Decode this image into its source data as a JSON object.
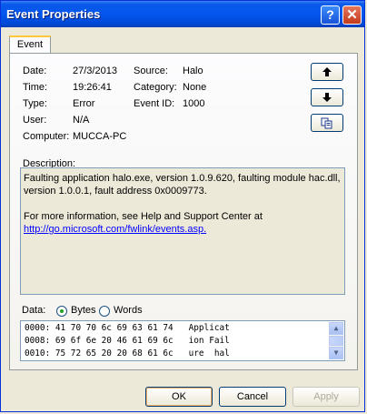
{
  "window": {
    "title": "Event Properties",
    "help_glyph": "?",
    "close_glyph": "✕"
  },
  "tab": {
    "label": "Event"
  },
  "fields": {
    "date_label": "Date:",
    "date_value": "27/3/2013",
    "time_label": "Time:",
    "time_value": "19:26:41",
    "type_label": "Type:",
    "type_value": "Error",
    "user_label": "User:",
    "user_value": "N/A",
    "computer_label": "Computer:",
    "computer_value": "MUCCA-PC",
    "source_label": "Source:",
    "source_value": "Halo",
    "category_label": "Category:",
    "category_value": "None",
    "eventid_label": "Event ID:",
    "eventid_value": "1000"
  },
  "nav": {
    "up_glyph": "🡑",
    "down_glyph": "🡓",
    "copy_icon": "copy-icon"
  },
  "description": {
    "label": "Description:",
    "line1": "Faulting application halo.exe, version 1.0.9.620, faulting module hac.dll,",
    "line2": "version 1.0.0.1, fault address 0x0009773.",
    "line3": "For more information, see Help and Support Center at",
    "link": "http://go.microsoft.com/fwlink/events.asp."
  },
  "data_section": {
    "label": "Data:",
    "bytes_label": "Bytes",
    "words_label": "Words",
    "selected": "Bytes",
    "rows": [
      "0000: 41 70 70 6c 69 63 61 74   Applicat",
      "0008: 69 6f 6e 20 46 61 69 6c   ion Fail",
      "0010: 75 72 65 20 20 68 61 6c   ure  hal"
    ]
  },
  "buttons": {
    "ok": "OK",
    "cancel": "Cancel",
    "apply": "Apply"
  }
}
